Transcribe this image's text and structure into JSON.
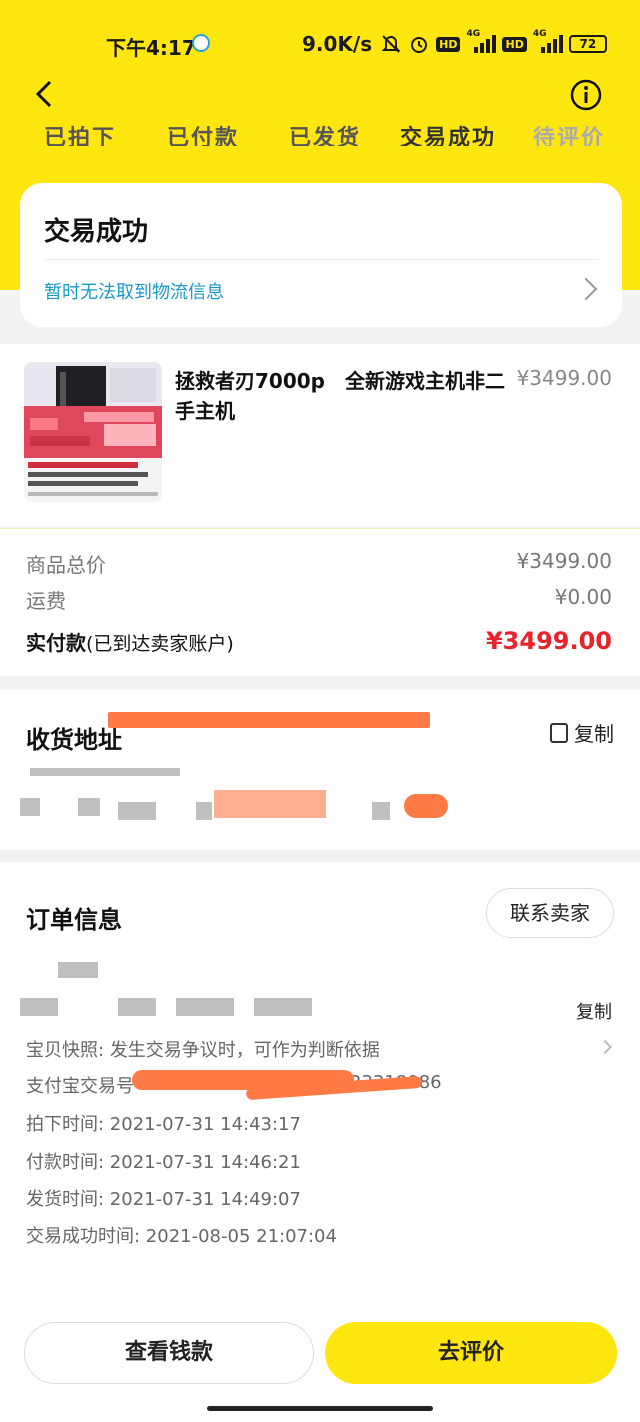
{
  "status_bar": {
    "time": "下午4:17",
    "network_speed": "9.0K/s",
    "signal_label_1": "4G",
    "signal_label_2": "4G",
    "hd_1": "HD",
    "hd_2": "HD",
    "battery": "72"
  },
  "progress_steps": [
    "已拍下",
    "已付款",
    "已发货",
    "交易成功",
    "待评价"
  ],
  "status_card": {
    "title": "交易成功",
    "logistics_text": "暂时无法取到物流信息"
  },
  "product": {
    "title": "拯救者刃7000p　全新游戏主机非二手主机",
    "price": "¥3499.00"
  },
  "summary": {
    "total_label": "商品总价",
    "total_value": "¥3499.00",
    "shipping_label": "运费",
    "shipping_value": "¥0.00",
    "paid_label": "实付款",
    "paid_note": "(已到达卖家账户)",
    "paid_value": "¥3499.00"
  },
  "address": {
    "title": "收货地址",
    "copy_label": "复制"
  },
  "order_info": {
    "title": "订单信息",
    "contact_button": "联系卖家",
    "copy_label": "复制",
    "snapshot": "宝贝快照: 发生交易争议时，可作为判断依据",
    "alipay_label": "支付宝交易号",
    "alipay_suffix": "23318086",
    "order_time": "拍下时间: 2021-07-31 14:43:17",
    "pay_time": "付款时间: 2021-07-31 14:46:21",
    "ship_time": "发货时间: 2021-07-31 14:49:07",
    "done_time": "交易成功时间: 2021-08-05 21:07:04"
  },
  "bottom_bar": {
    "view_money": "查看钱款",
    "review": "去评价"
  },
  "colors": {
    "brand_yellow": "#ffe60f",
    "price_red": "#e8232c",
    "link_blue": "#1899c9",
    "redaction_orange": "#ff7a45"
  }
}
